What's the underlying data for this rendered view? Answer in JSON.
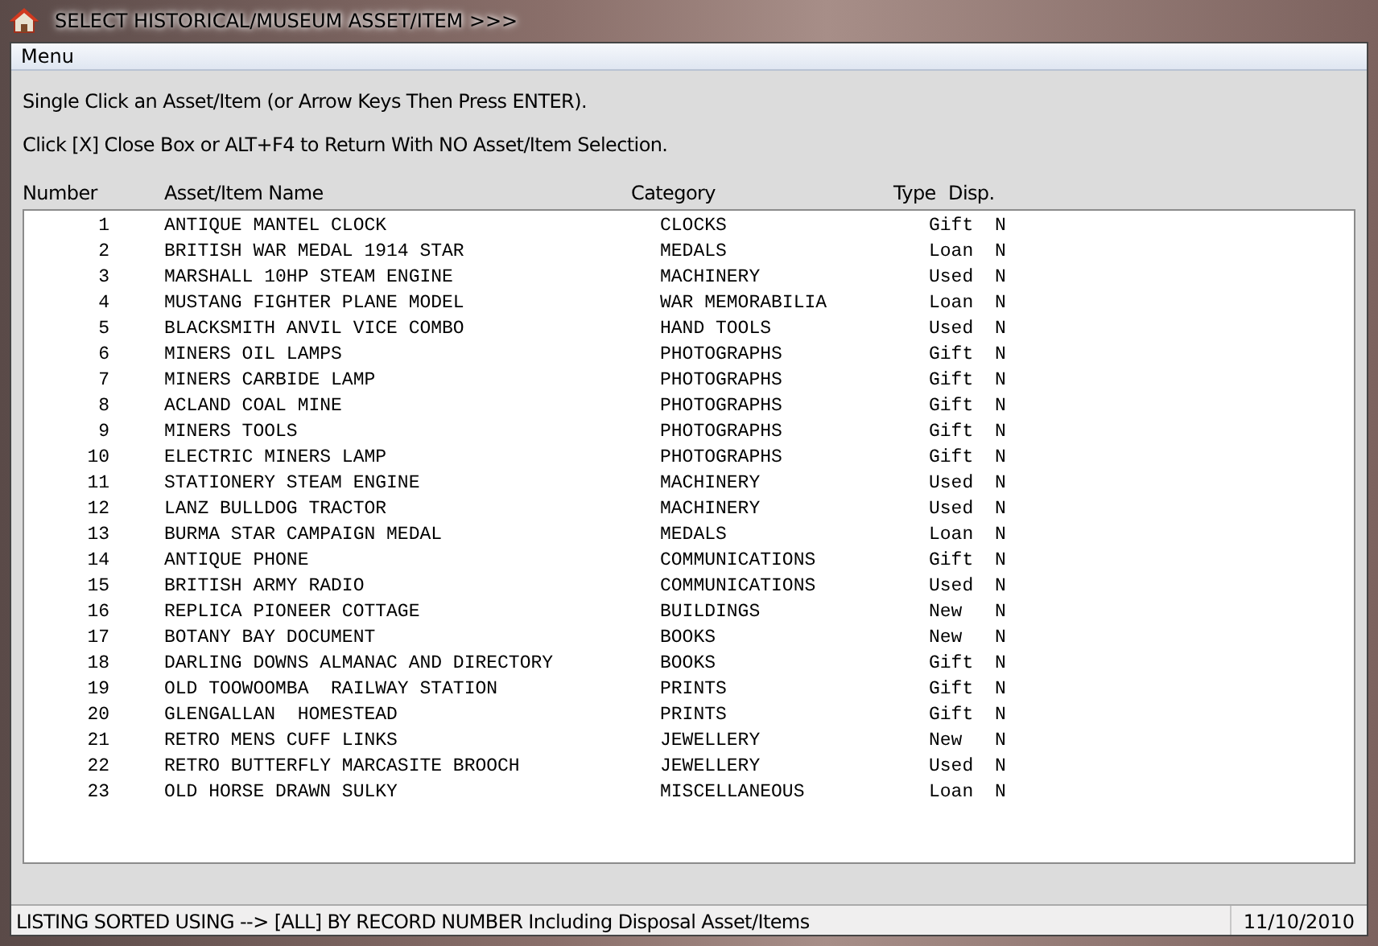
{
  "window": {
    "title": "SELECT HISTORICAL/MUSEUM ASSET/ITEM >>>"
  },
  "menu": [
    "Menu"
  ],
  "instructions": [
    "Single Click an Asset/Item (or Arrow Keys Then Press ENTER).",
    "Click [X] Close Box or ALT+F4 to Return With NO Asset/Item Selection."
  ],
  "table": {
    "columns": [
      "Number",
      "Asset/Item Name",
      "Category",
      "Type",
      "Disp."
    ],
    "rows": [
      [
        "1",
        "ANTIQUE MANTEL CLOCK",
        "CLOCKS",
        "Gift",
        "N"
      ],
      [
        "2",
        "BRITISH WAR MEDAL 1914 STAR",
        "MEDALS",
        "Loan",
        "N"
      ],
      [
        "3",
        "MARSHALL 10HP STEAM ENGINE",
        "MACHINERY",
        "Used",
        "N"
      ],
      [
        "4",
        "MUSTANG FIGHTER PLANE MODEL",
        "WAR MEMORABILIA",
        "Loan",
        "N"
      ],
      [
        "5",
        "BLACKSMITH ANVIL VICE COMBO",
        "HAND TOOLS",
        "Used",
        "N"
      ],
      [
        "6",
        "MINERS OIL LAMPS",
        "PHOTOGRAPHS",
        "Gift",
        "N"
      ],
      [
        "7",
        "MINERS CARBIDE LAMP",
        "PHOTOGRAPHS",
        "Gift",
        "N"
      ],
      [
        "8",
        "ACLAND COAL MINE",
        "PHOTOGRAPHS",
        "Gift",
        "N"
      ],
      [
        "9",
        "MINERS TOOLS",
        "PHOTOGRAPHS",
        "Gift",
        "N"
      ],
      [
        "10",
        "ELECTRIC MINERS LAMP",
        "PHOTOGRAPHS",
        "Gift",
        "N"
      ],
      [
        "11",
        "STATIONERY STEAM ENGINE",
        "MACHINERY",
        "Used",
        "N"
      ],
      [
        "12",
        "LANZ BULLDOG TRACTOR",
        "MACHINERY",
        "Used",
        "N"
      ],
      [
        "13",
        "BURMA STAR CAMPAIGN MEDAL",
        "MEDALS",
        "Loan",
        "N"
      ],
      [
        "14",
        "ANTIQUE PHONE",
        "COMMUNICATIONS",
        "Gift",
        "N"
      ],
      [
        "15",
        "BRITISH ARMY RADIO",
        "COMMUNICATIONS",
        "Used",
        "N"
      ],
      [
        "16",
        "REPLICA PIONEER COTTAGE",
        "BUILDINGS",
        "New",
        "N"
      ],
      [
        "17",
        "BOTANY BAY DOCUMENT",
        "BOOKS",
        "New",
        "N"
      ],
      [
        "18",
        "DARLING DOWNS ALMANAC AND DIRECTORY",
        "BOOKS",
        "Gift",
        "N"
      ],
      [
        "19",
        "OLD TOOWOOMBA  RAILWAY STATION",
        "PRINTS",
        "Gift",
        "N"
      ],
      [
        "20",
        "GLENGALLAN  HOMESTEAD",
        "PRINTS",
        "Gift",
        "N"
      ],
      [
        "21",
        "RETRO MENS CUFF LINKS",
        "JEWELLERY",
        "New",
        "N"
      ],
      [
        "22",
        "RETRO BUTTERFLY MARCASITE BROOCH",
        "JEWELLERY",
        "Used",
        "N"
      ],
      [
        "23",
        "OLD HORSE DRAWN SULKY",
        "MISCELLANEOUS",
        "Loan",
        "N"
      ]
    ]
  },
  "status_bar": [
    "LISTING SORTED USING --> [ALL] BY RECORD NUMBER Including Disposal Asset/Items",
    "11/10/2010"
  ]
}
